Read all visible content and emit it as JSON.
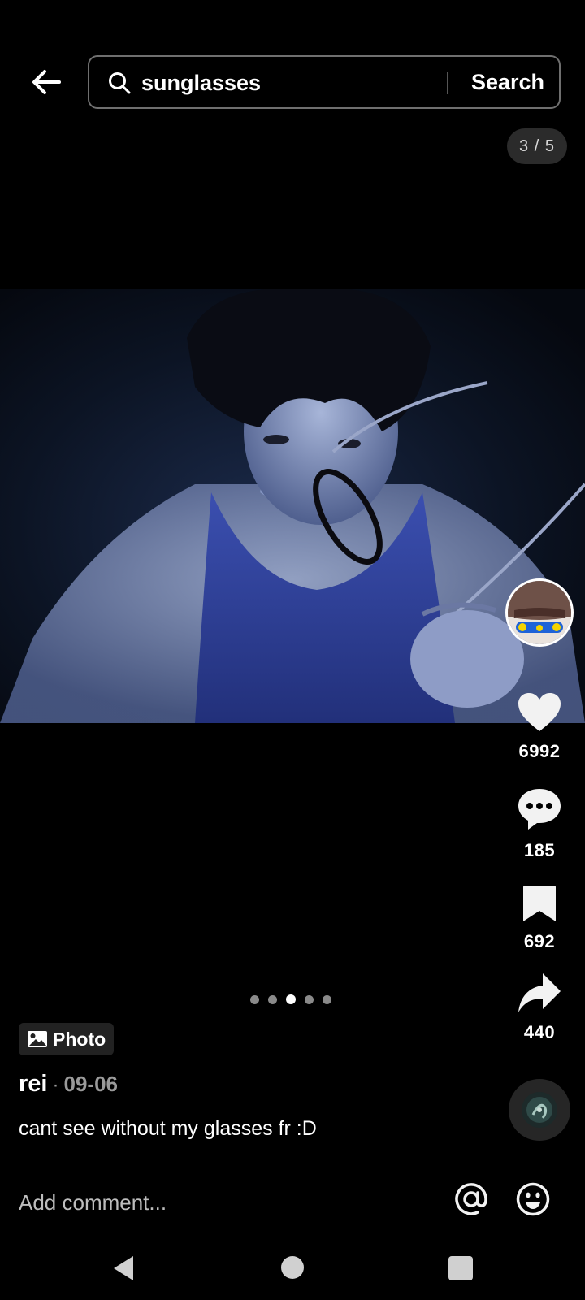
{
  "header": {
    "back_icon": "arrow-left-icon",
    "search_icon": "search-icon",
    "search_query": "sunglasses",
    "search_button_label": "Search"
  },
  "post": {
    "photo_index_label": "3 / 5",
    "current_photo": 3,
    "total_photos": 5,
    "type_tag_icon": "image-icon",
    "type_tag_label": "Photo",
    "author": "rei",
    "separator": "·",
    "date": "09-06",
    "caption": "cant see without my glasses fr :D"
  },
  "actions": {
    "likes": {
      "icon": "heart-icon",
      "count": "6992"
    },
    "comments": {
      "icon": "comment-icon",
      "count": "185"
    },
    "saves": {
      "icon": "bookmark-icon",
      "count": "692"
    },
    "shares": {
      "icon": "share-icon",
      "count": "440"
    }
  },
  "comment_bar": {
    "placeholder": "Add comment...",
    "mention_icon": "at-icon",
    "emoji_icon": "emoji-icon"
  },
  "system_nav": {
    "back_icon": "triangle-back-icon",
    "home_icon": "circle-home-icon",
    "recents_icon": "square-recents-icon"
  },
  "colors": {
    "background": "#000000",
    "secondary_text": "#9a9a9a",
    "chip_background": "#2b2b2b"
  }
}
